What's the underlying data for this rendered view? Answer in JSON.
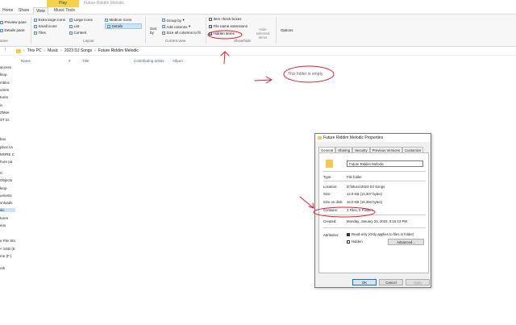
{
  "window": {
    "contextual_tab": "Play",
    "title": "Future Riddim Melodic"
  },
  "tabs": [
    "Home",
    "Share",
    "View",
    "Music Tools"
  ],
  "ribbon": {
    "panes": {
      "preview": "Preview pane",
      "details": "Details pane",
      "group_label": "anes"
    },
    "layout": {
      "items": [
        "Extra large icons",
        "Large icons",
        "Medium icons",
        "Small icons",
        "List",
        "Details",
        "Tiles",
        "Content"
      ],
      "group_label": "Layout"
    },
    "current_view": {
      "sort": "Sort by",
      "group_by": "Group by",
      "add_columns": "Add columns",
      "size_all": "Size all columns to fit",
      "group_label": "Current view"
    },
    "show_hide": {
      "item_check_boxes": "Item check boxes",
      "file_name_extensions": "File name extensions",
      "hidden_items": "Hidden items",
      "hide_selected": "Hide selected items",
      "group_label": "Show/hide"
    },
    "options": "Options"
  },
  "address": {
    "crumbs": [
      "This PC",
      "Music",
      "2023 DJ Songs",
      "Future Riddim Melodic"
    ]
  },
  "nav_pane": {
    "items": [
      "access",
      "ktop",
      "mbloc",
      "umen",
      "tures",
      "ic",
      "ZMee",
      "ST to",
      "box",
      "pbox.ca",
      "MORE C",
      "hore pa",
      "C",
      "Objects",
      "ktop",
      "uments",
      "vnloads",
      "sic",
      "tures",
      "eos",
      "e File Sto",
      "< SSD (E)",
      "me (F:)",
      "ork"
    ]
  },
  "file_list": {
    "columns": [
      "Name",
      "#",
      "Title",
      "Contributing artists",
      "Album"
    ],
    "empty_message": "This folder is empty."
  },
  "dialog": {
    "title": "Future Riddim Melodic Properties",
    "tabs": [
      "General",
      "Sharing",
      "Security",
      "Previous Versions",
      "Customize"
    ],
    "folder_name": "Future Riddim Melodic",
    "rows": {
      "type_label": "Type:",
      "type_value": "File folder",
      "location_label": "Location:",
      "location_value": "D:\\Music\\2023 DJ Songs",
      "size_label": "Size:",
      "size_value": "12.9 KB (13,307 bytes)",
      "size_on_disk_label": "Size on disk:",
      "size_on_disk_value": "16.0 KB (16,384 bytes)",
      "contains_label": "Contains:",
      "contains_value": "2 Files, 0 Folders",
      "created_label": "Created:",
      "created_value": "Monday, January 23, 2023, 8:16:13 PM",
      "attributes_label": "Attributes:"
    },
    "read_only": "Read-only (Only applies to files in folder)",
    "hidden": "Hidden",
    "advanced": "Advanced...",
    "ok": "OK",
    "cancel": "Cancel",
    "apply": "Apply"
  },
  "colors": {
    "accent": "#0078d7",
    "annotation": "#e0202a",
    "play_tab": "#f3d34c"
  }
}
